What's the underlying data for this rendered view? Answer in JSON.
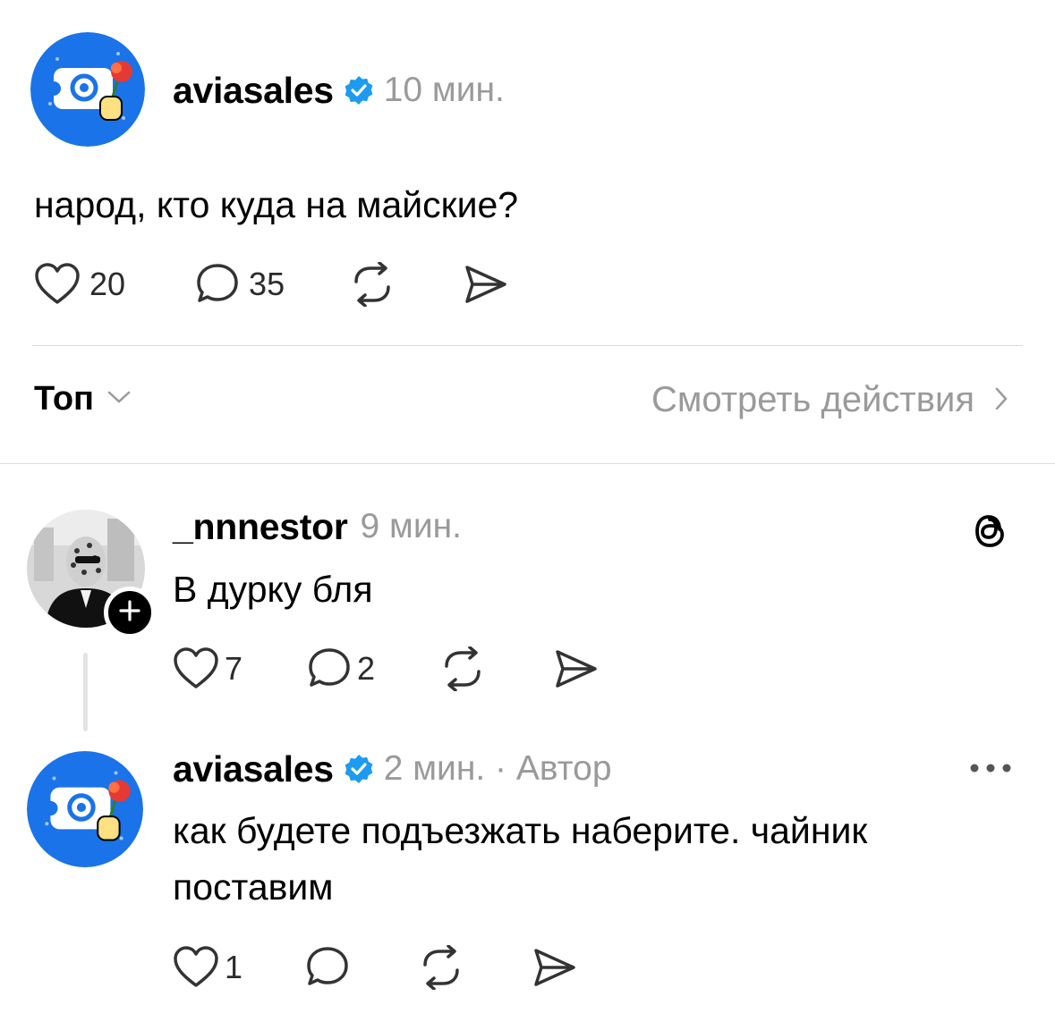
{
  "post": {
    "username": "aviasales",
    "time": "10 мин.",
    "text": "народ, кто куда на майские?",
    "likes": "20",
    "comments": "35"
  },
  "sort": {
    "label": "Топ",
    "activity_link": "Смотреть действия"
  },
  "replies": [
    {
      "username": "_nnnestor",
      "time": "9 мин.",
      "text": "В дурку бля",
      "likes": "7",
      "comments": "2"
    },
    {
      "username": "aviasales",
      "time": "2 мин. · Автор",
      "text": "как будете подъезжать наберите. чайник поставим",
      "likes": "1",
      "comments": ""
    }
  ],
  "icons": [
    "heart-icon",
    "comment-icon",
    "repost-icon",
    "share-icon",
    "verified-icon",
    "threads-icon",
    "more-icon",
    "chevron-down-icon",
    "chevron-right-icon",
    "plus-icon"
  ],
  "colors": {
    "accent": "#1d9bf0",
    "avatar_bg": "#1a73e8",
    "muted": "#9a9a9a"
  }
}
